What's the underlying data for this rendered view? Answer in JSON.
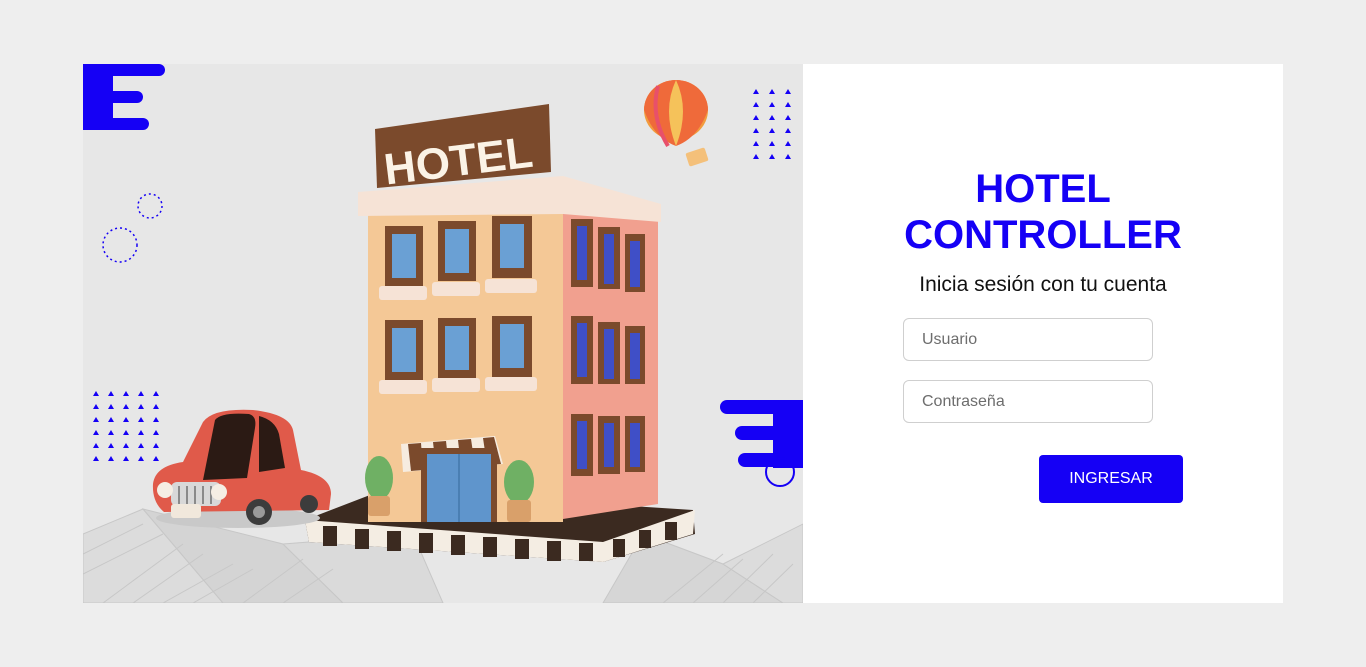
{
  "header": {
    "title_line1": "HOTEL",
    "title_line2": "CONTROLLER",
    "subtitle": "Inicia sesión con tu cuenta"
  },
  "hero": {
    "sign_text": "HOTEL"
  },
  "form": {
    "username_placeholder": "Usuario",
    "password_placeholder": "Contraseña",
    "submit_label": "INGRESAR"
  },
  "colors": {
    "accent": "#1500f5",
    "page_background": "#eeeeee"
  }
}
